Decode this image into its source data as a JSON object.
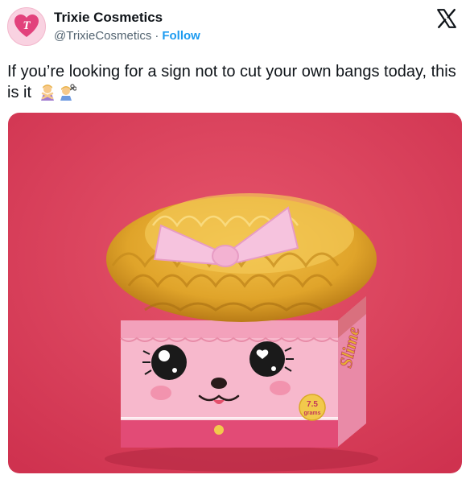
{
  "account": {
    "name": "Trixie Cosmetics",
    "handle": "@TrixieCosmetics",
    "separator": "·",
    "follow_label": "Follow",
    "avatar_letter": "T"
  },
  "tweet": {
    "text": "If you’re looking for a sign not to cut your own bangs today, this is it",
    "emojis": [
      "person-gesturing-no-emoji",
      "person-getting-haircut-emoji"
    ]
  },
  "media": {
    "box_label_weight": "7.5",
    "box_label_unit": "grams",
    "box_side_text": "Slime",
    "bow_color": "#f6c3de",
    "background_color": "#e0445f"
  },
  "icons": {
    "close": "x-logo-icon"
  }
}
